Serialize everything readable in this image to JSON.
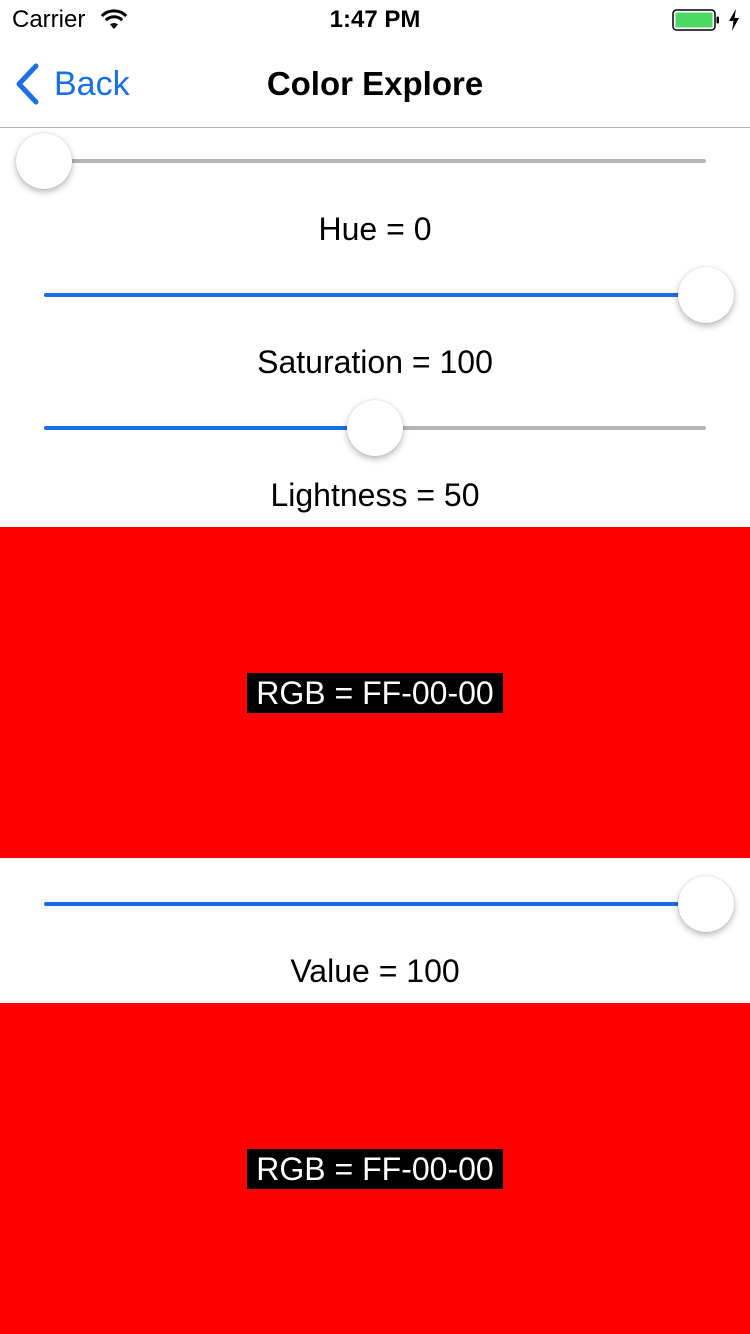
{
  "status_bar": {
    "carrier": "Carrier",
    "time": "1:47 PM",
    "battery_color": "#4cd964"
  },
  "nav": {
    "back_label": "Back",
    "title": "Color Explore",
    "tint": "#1a6fe6"
  },
  "hsl": {
    "hue_slider_value": 0,
    "hue_label": "Hue = 0",
    "saturation_slider_value": 1.0,
    "saturation_label": "Saturation = 100",
    "lightness_slider_value": 0.5,
    "lightness_label": "Lightness = 50",
    "swatch_color": "#ff0000",
    "rgb_label": "RGB = FF-00-00"
  },
  "hsv": {
    "value_slider_value": 1.0,
    "value_label": "Value = 100",
    "swatch_color": "#ff0000",
    "rgb_label": "RGB = FF-00-00"
  }
}
